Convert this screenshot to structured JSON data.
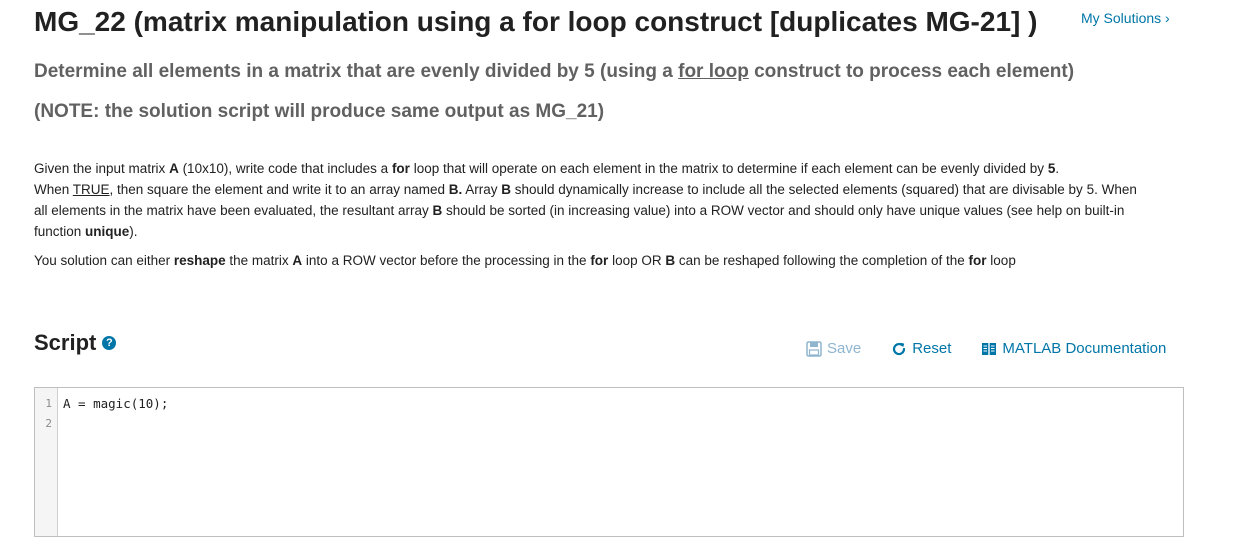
{
  "header": {
    "title": "MG_22 (matrix manipulation using a for loop construct [duplicates MG-21] )",
    "my_solutions": "My Solutions ›"
  },
  "subtitle1": {
    "before": "Determine all elements in a matrix that are evenly divided by 5 (using a ",
    "link": "for loop",
    "after": " construct to process each element)"
  },
  "subtitle2": "(NOTE: the solution script will produce same output as MG_21)",
  "description": {
    "p1": [
      "Given the input matrix ",
      "A",
      "  (10x10), write code that includes a ",
      "for",
      " loop that will operate on each element in the matrix to determine if each element can be evenly divided by ",
      "5",
      ".",
      "When ",
      "TRUE",
      ", then square the element and write it to an array named ",
      "B.",
      "   Array ",
      "B",
      " should dynamically increase to include all the selected elements (squared) that are divisable by 5.   When all elements in the matrix have been evaluated, the resultant array ",
      "B",
      " should be sorted (in increasing value) into a ROW vector and should only have unique values  (see help on built-in function ",
      "unique",
      ")."
    ],
    "p2": [
      "You solution can either ",
      "reshape",
      " the matrix ",
      "A",
      " into a ROW vector before the processing in the ",
      "for",
      " loop OR ",
      "B",
      " can be reshaped following the completion of the ",
      "for",
      " loop"
    ]
  },
  "script": {
    "heading": "Script",
    "help_glyph": "?",
    "save_label": "Save",
    "reset_label": "Reset",
    "doc_label": "MATLAB Documentation"
  },
  "editor": {
    "lines": [
      "A = magic(10);",
      ""
    ],
    "line_numbers": [
      "1",
      "2"
    ]
  },
  "colors": {
    "link": "#0076a8",
    "save_disabled": "#8fb5cf",
    "subtitle": "#616161"
  },
  "icons": {
    "save": "floppy-disk-icon",
    "reset": "refresh-icon",
    "doc": "book-icon",
    "help": "question-circle-icon",
    "chevron": "chevron-right-icon"
  }
}
